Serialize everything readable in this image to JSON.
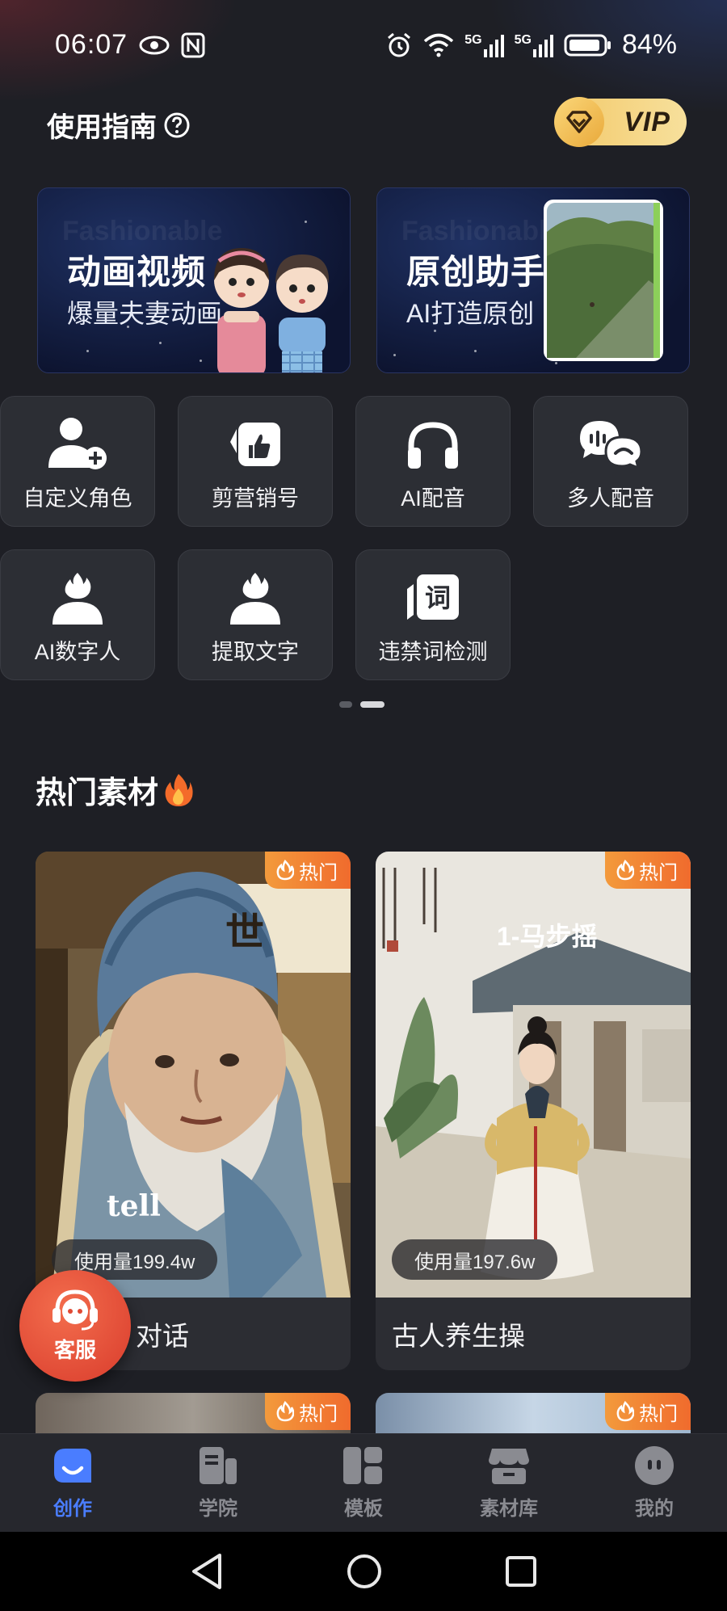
{
  "status_bar": {
    "time": "06:07",
    "battery_pct": "84%",
    "net1": "5G",
    "net2": "5G"
  },
  "header": {
    "guide_label": "使用指南",
    "vip_label": "VIP"
  },
  "banners": [
    {
      "ghost": "Fashionable",
      "title": "动画视频",
      "subtitle": "爆量夫妻动画"
    },
    {
      "ghost": "Fashionable",
      "title": "原创助手",
      "subtitle": "AI打造原创"
    }
  ],
  "tools": [
    {
      "label": "自定义角色",
      "icon": "person-add-icon"
    },
    {
      "label": "剪营销号",
      "icon": "thumbs-up-icon"
    },
    {
      "label": "AI配音",
      "icon": "headphones-icon"
    },
    {
      "label": "多人配音",
      "icon": "chat-bubbles-icon"
    },
    {
      "label": "AI数字人",
      "icon": "flame-person-icon"
    },
    {
      "label": "提取文字",
      "icon": "flame-person-icon"
    },
    {
      "label": "违禁词检测",
      "icon": "word-check-icon"
    }
  ],
  "pager": {
    "count": 2,
    "active": 2
  },
  "section": {
    "title": "热门素材"
  },
  "cards": [
    {
      "badge": "热门",
      "usage": "使用量199.4w",
      "caption": "对话",
      "overlay": "tell",
      "sign": "世"
    },
    {
      "badge": "热门",
      "usage": "使用量197.6w",
      "caption": "古人养生操",
      "overlay": "1-马步摇"
    },
    {
      "badge": "热门"
    },
    {
      "badge": "热门"
    }
  ],
  "service": {
    "label": "客服"
  },
  "nav": [
    {
      "label": "创作",
      "active": true
    },
    {
      "label": "学院",
      "active": false
    },
    {
      "label": "模板",
      "active": false
    },
    {
      "label": "素材库",
      "active": false
    },
    {
      "label": "我的",
      "active": false
    }
  ],
  "colors": {
    "accent": "#4a7dff",
    "hot": "#f06b2d",
    "vip": "#f3c96a",
    "bg": "#1e1f25"
  }
}
